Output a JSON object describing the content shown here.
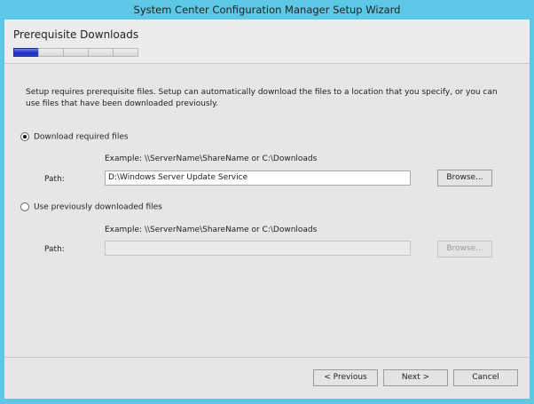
{
  "window": {
    "title": "System Center Configuration Manager Setup Wizard"
  },
  "header": {
    "title": "Prerequisite Downloads",
    "steps_total": 5,
    "current_step": 1
  },
  "main": {
    "description": "Setup requires prerequisite files. Setup can automatically download the files to a location that you specify, or you can use files that have been downloaded previously.",
    "option_download": {
      "label": "Download required files",
      "selected": true,
      "example": "Example: \\\\ServerName\\ShareName or C:\\Downloads",
      "path_label": "Path:",
      "path_value": "D:\\Windows Server Update Service",
      "browse": "Browse..."
    },
    "option_existing": {
      "label": "Use previously downloaded files",
      "selected": false,
      "example": "Example: \\\\ServerName\\ShareName or C:\\Downloads",
      "path_label": "Path:",
      "path_value": "",
      "browse": "Browse..."
    }
  },
  "footer": {
    "previous": "< Previous",
    "next": "Next >",
    "cancel": "Cancel"
  }
}
